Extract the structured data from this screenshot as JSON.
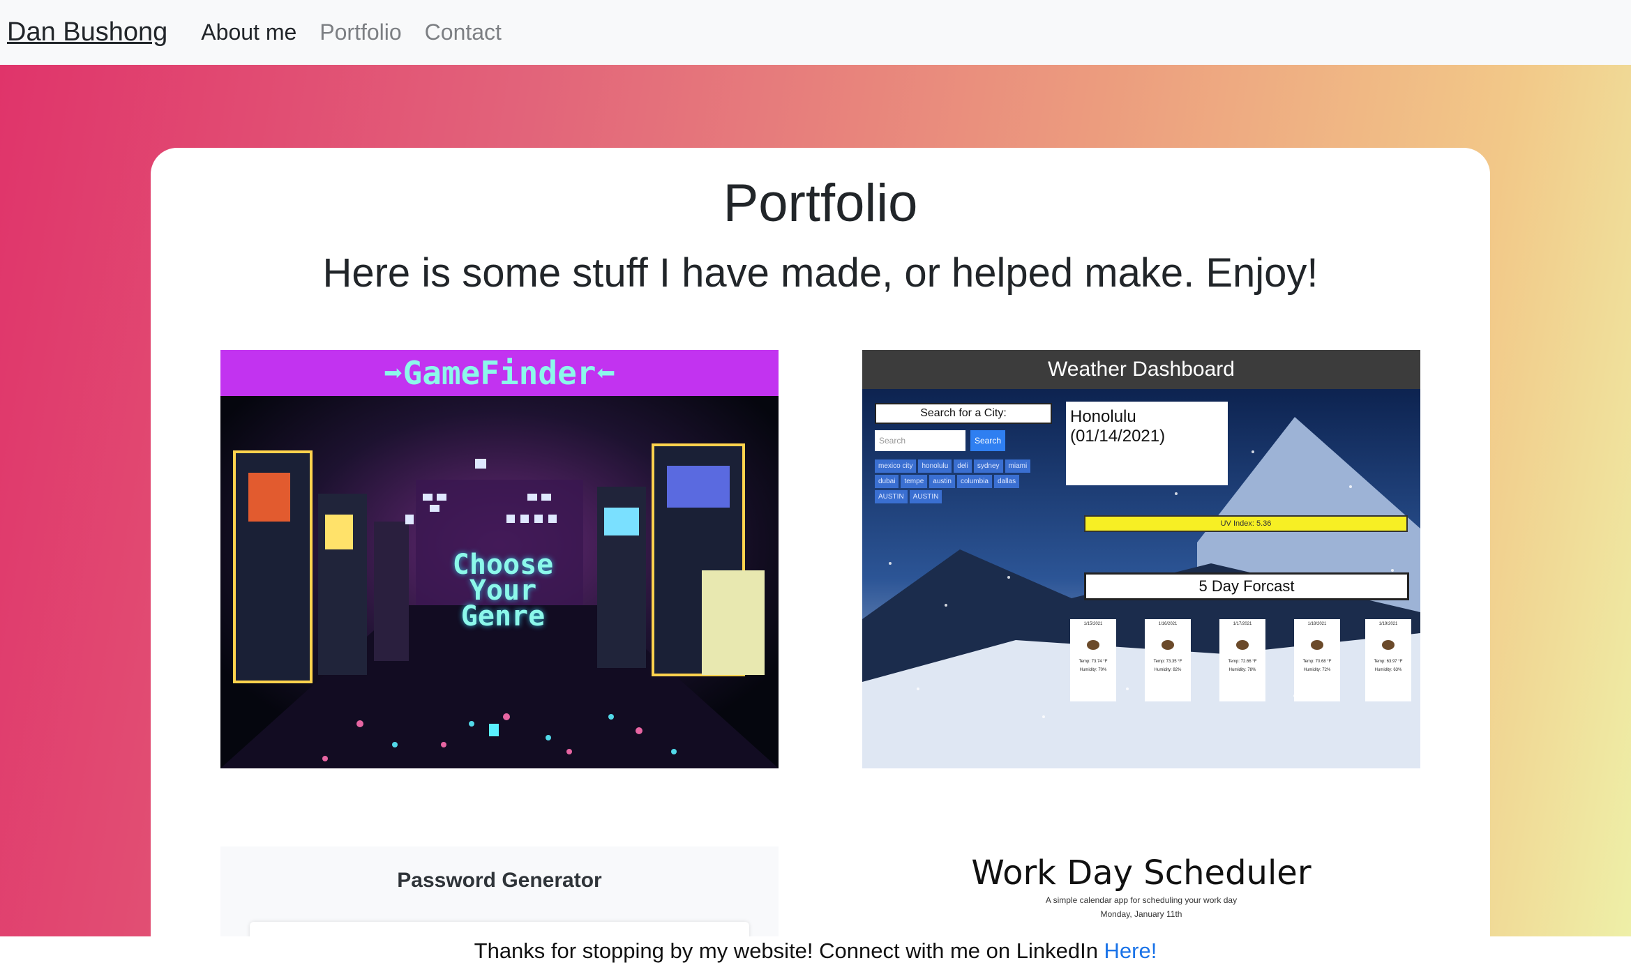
{
  "nav": {
    "brand": "Dan Bushong",
    "links": [
      {
        "label": "About me"
      },
      {
        "label": "Portfolio"
      },
      {
        "label": "Contact"
      }
    ]
  },
  "main": {
    "title": "Portfolio",
    "subtitle": "Here is some stuff I have made, or helped make. Enjoy!"
  },
  "projects": {
    "gamefinder": {
      "banner": "GameFinder",
      "overlay": "Choose Your Genre"
    },
    "weather": {
      "header": "Weather Dashboard",
      "search_title": "Search for a City:",
      "search_placeholder": "Search",
      "search_button": "Search",
      "cities": [
        "mexico city",
        "honolulu",
        "deli",
        "sydney",
        "miami",
        "dubai",
        "tempe",
        "austin",
        "columbia",
        "dallas",
        "AUSTIN",
        "AUSTIN"
      ],
      "current_city": "Honolulu (01/14/2021)",
      "uv_index": "UV Index: 5.36",
      "forecast_title": "5 Day Forcast",
      "forecast": [
        {
          "date": "1/15/2021",
          "temp": "Temp: 73.74 °F",
          "humidity": "Humidity: 70%"
        },
        {
          "date": "1/16/2021",
          "temp": "Temp: 73.35 °F",
          "humidity": "Humidity: 82%"
        },
        {
          "date": "1/17/2021",
          "temp": "Temp: 72.66 °F",
          "humidity": "Humidity: 78%"
        },
        {
          "date": "1/18/2021",
          "temp": "Temp: 70.68 °F",
          "humidity": "Humidity: 72%"
        },
        {
          "date": "1/19/2021",
          "temp": "Temp: 63.97 °F",
          "humidity": "Humidity: 63%"
        }
      ]
    },
    "password": {
      "title": "Password Generator"
    },
    "scheduler": {
      "title": "Work Day Scheduler",
      "subtitle": "A simple calendar app for scheduling your work day",
      "date": "Monday, January 11th"
    }
  },
  "footer": {
    "text": "Thanks for stopping by my website! Connect with me on LinkedIn ",
    "link_label": "Here!"
  },
  "colors": {
    "accent_link": "#1a73e8",
    "gamefinder_banner": "#c233f0",
    "uv_bar": "#f7ef24"
  }
}
